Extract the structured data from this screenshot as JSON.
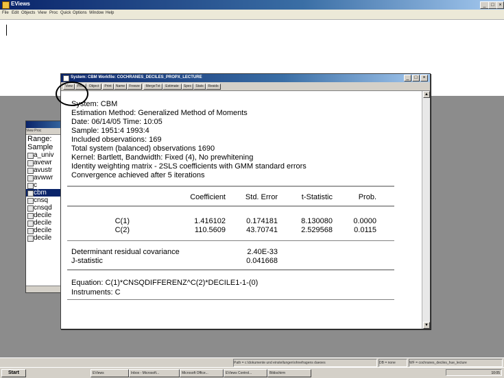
{
  "app": {
    "title": "EViews",
    "menu": [
      "File",
      "Edit",
      "Objects",
      "View",
      "Proc",
      "Quick",
      "Options",
      "Window",
      "Help"
    ],
    "window_controls": [
      "_",
      "□",
      "×"
    ]
  },
  "system_window": {
    "title": "System: CBM   Workfile: COCHRANES_DECILES_PROPX_LECTURE",
    "toolbar": [
      "View",
      "Proc",
      "Object",
      "Print",
      "Name",
      "Freeze",
      "MergeTxt",
      "Estimate",
      "Spec",
      "Stats",
      "Resids"
    ],
    "header_lines": [
      "System: CBM",
      "Estimation Method: Generalized Method of Moments",
      "Date: 06/14/05   Time: 10:05",
      "Sample: 1951:4 1993:4",
      "Included observations: 169",
      "Total system (balanced) observations 1690",
      "Kernel: Bartlett,  Bandwidth: Fixed (4),  No prewhitening",
      "Identity weighting matrix - 2SLS coefficients with GMM standard errors",
      "Convergence achieved after 5 iterations"
    ],
    "table": {
      "columns": [
        "Coefficient",
        "Std. Error",
        "t-Statistic",
        "Prob."
      ],
      "rows": [
        {
          "name": "C(1)",
          "coef": "1.416102",
          "se": "0.174181",
          "t": "8.130080",
          "p": "0.0000"
        },
        {
          "name": "C(2)",
          "coef": "110.5609",
          "se": "43.70741",
          "t": "2.529568",
          "p": "0.0115"
        }
      ]
    },
    "stats": [
      {
        "label": "Determinant residual covariance",
        "value": "2.40E-33"
      },
      {
        "label": "J-statistic",
        "value": "0.041668"
      }
    ],
    "equation": "Equation: C(1)*CNSQDIFFERENZ^C(2)*DECILE1-1-(0)",
    "instruments": "Instruments: C"
  },
  "workfile_window": {
    "range_label": "Range:",
    "sample_label": "Sample",
    "items": [
      "a_univ",
      "avewr",
      "avustr",
      "avwwr",
      "c",
      "cbm",
      "cnsq",
      "cnsqd",
      "decile",
      "decile",
      "decile",
      "decile"
    ],
    "selected": "cbm"
  },
  "statusbar": {
    "path": "Path = c:\\dokumente und einstellungen\\ohnefragens daeoes",
    "db": "DB = none",
    "wf": "WF = cochranes_deciles_hue_lecture"
  },
  "taskbar": {
    "start": "Start",
    "tasks": [
      "EViews",
      "Inbox - Microsoft...",
      "Microsoft Office...",
      "EViews Control...",
      "Bildschirm"
    ],
    "clock": "10:05"
  }
}
